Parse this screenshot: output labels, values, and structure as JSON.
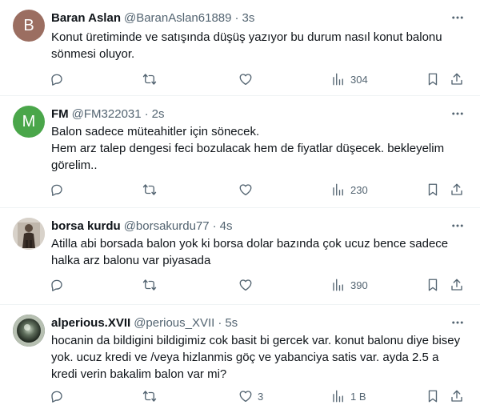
{
  "tweets": [
    {
      "avatar_letter": "B",
      "avatar_color": "#9b6e61",
      "name": "Baran Aslan",
      "handle": "@BaranAslan61889",
      "dot": "·",
      "time": "3s",
      "text": "Konut üretiminde ve satışında düşüş yazıyor bu durum nasıl  konut balonu sönmesi oluyor.",
      "replies": "",
      "retweets": "",
      "likes": "",
      "views": "304"
    },
    {
      "avatar_letter": "M",
      "avatar_color": "#4aa64a",
      "name": "FM",
      "handle": "@FM322031",
      "dot": "·",
      "time": "2s",
      "text": "Balon sadece müteahitler için sönecek.\nHem arz talep dengesi feci bozulacak hem de fiyatlar düşecek. bekleyelim görelim..",
      "replies": "",
      "retweets": "",
      "likes": "",
      "views": "230"
    },
    {
      "avatar_letter": "",
      "avatar_color": "#6d6358",
      "name": "borsa kurdu",
      "handle": "@borsakurdu77",
      "dot": "·",
      "time": "4s",
      "text": "Atilla abi borsada balon yok ki borsa dolar bazında çok ucuz bence sadece halka arz balonu var piyasada",
      "replies": "",
      "retweets": "",
      "likes": "",
      "views": "390"
    },
    {
      "avatar_letter": "",
      "avatar_color": "#3e4a3e",
      "name": "alperious.XVII",
      "handle": "@perious_XVII",
      "dot": "·",
      "time": "5s",
      "text": "hocanin da bildigini bildigimiz cok basit bi gercek var. konut balonu diye bisey yok. ucuz kredi ve /veya hizlanmis göç ve yabanciya satis var. ayda 2.5 a kredi verin bakalim balon var mi?",
      "replies": "",
      "retweets": "",
      "likes": "3",
      "views": "1 B"
    }
  ]
}
